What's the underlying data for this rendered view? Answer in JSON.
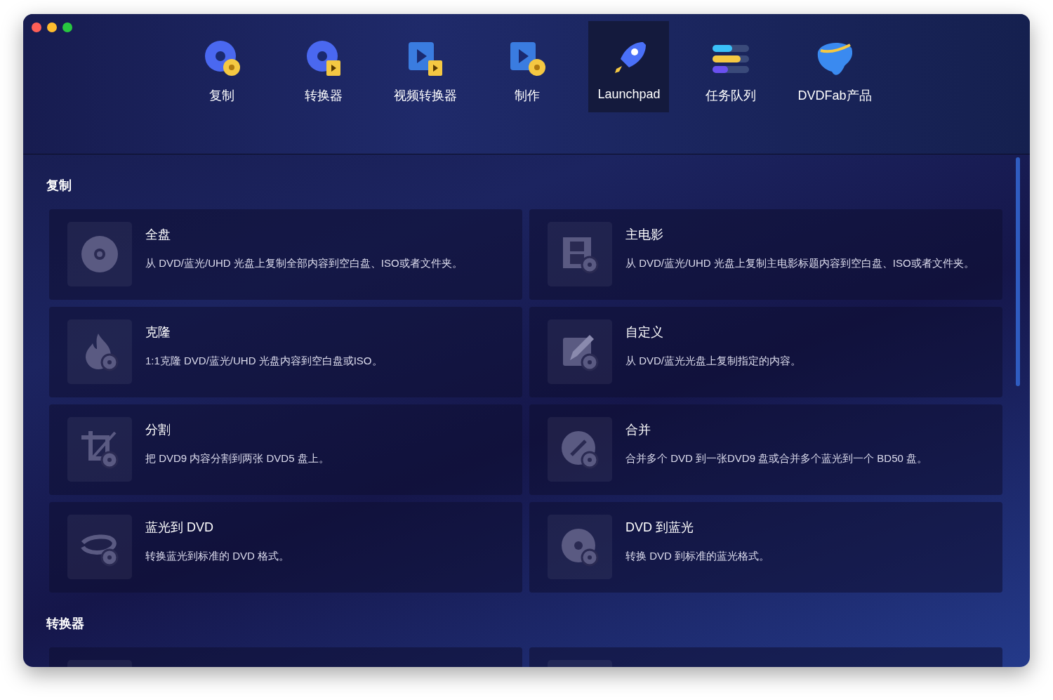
{
  "window": {
    "controls": [
      {
        "color": "#fe5f57"
      },
      {
        "color": "#febc2e"
      },
      {
        "color": "#28c840"
      }
    ]
  },
  "tabs": [
    {
      "label": "复制",
      "kind": "copy",
      "selected": false
    },
    {
      "label": "转换器",
      "kind": "ripper",
      "selected": false
    },
    {
      "label": "视频转换器",
      "kind": "video",
      "selected": false
    },
    {
      "label": "制作",
      "kind": "creator",
      "selected": false
    },
    {
      "label": "Launchpad",
      "kind": "launchpad",
      "selected": true
    },
    {
      "label": "任务队列",
      "kind": "queue",
      "selected": false
    },
    {
      "label": "DVDFab产品",
      "kind": "products",
      "selected": false
    }
  ],
  "sections": [
    {
      "title": "复制",
      "cards": [
        {
          "kind": "disc",
          "title": "全盘",
          "description": "从 DVD/蓝光/UHD 光盘上复制全部内容到空白盘、ISO或者文件夹。"
        },
        {
          "kind": "film",
          "title": "主电影",
          "description": "从 DVD/蓝光/UHD 光盘上复制主电影标题内容到空白盘、ISO或者文件夹。"
        },
        {
          "kind": "flame",
          "title": "克隆",
          "description": "1:1克隆 DVD/蓝光/UHD 光盘内容到空白盘或ISO。"
        },
        {
          "kind": "edit",
          "title": "自定义",
          "description": "从 DVD/蓝光光盘上复制指定的内容。"
        },
        {
          "kind": "crop",
          "title": "分割",
          "description": "把 DVD9 内容分割到两张 DVD5 盘上。"
        },
        {
          "kind": "link",
          "title": "合并",
          "description": "合并多个 DVD 到一张DVD9 盘或合并多个蓝光到一个 BD50 盘。"
        },
        {
          "kind": "bluray",
          "title": "蓝光到 DVD",
          "description": "转换蓝光到标准的 DVD 格式。"
        },
        {
          "kind": "disc2",
          "title": "DVD 到蓝光",
          "description": "转换 DVD 到标准的蓝光格式。"
        }
      ]
    },
    {
      "title": "转换器",
      "cards": [
        {
          "kind": "blank"
        },
        {
          "kind": "blank"
        }
      ]
    }
  ]
}
